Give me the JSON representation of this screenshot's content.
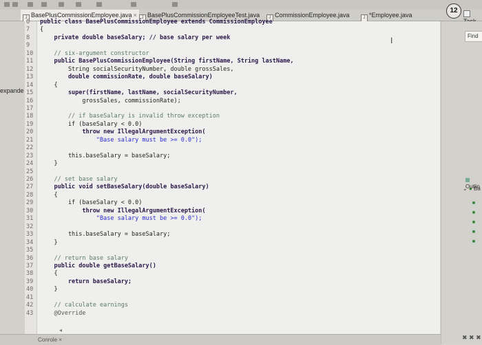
{
  "tabs": [
    {
      "label": "BasePlusCommissionEmployee.java",
      "active": true,
      "closable": true
    },
    {
      "label": "BasePlusCommissionEmployeeTest.java",
      "active": false
    },
    {
      "label": "CommissionEmployee.java",
      "active": false
    },
    {
      "label": "*Employee.java",
      "active": false
    }
  ],
  "badge_count": "12",
  "task_tab": "Task",
  "find_label": "Find",
  "outline_label": "Outlin",
  "outline_item": "Ba",
  "expand_label": "expande",
  "console_tab": "Conrole",
  "close_glyph": "×",
  "bottom_tools": "✖ ✖ ✖",
  "code_lines": [
    {
      "n": "6",
      "text": "public class BasePlusCommissionEmployee extends CommissionEmployee"
    },
    {
      "n": "7",
      "text": "{"
    },
    {
      "n": "8",
      "text": "    private double baseSalary; // base salary per week"
    },
    {
      "n": "9",
      "text": ""
    },
    {
      "n": "10",
      "text": "    // six-argument constructor"
    },
    {
      "n": "11",
      "text": "    public BasePlusCommissionEmployee(String firstName, String lastName,"
    },
    {
      "n": "12",
      "text": "        String socialSecurityNumber, double grossSales,"
    },
    {
      "n": "13",
      "text": "        double commissionRate, double baseSalary)"
    },
    {
      "n": "14",
      "text": "    {"
    },
    {
      "n": "15",
      "text": "        super(firstName, lastName, socialSecurityNumber,"
    },
    {
      "n": "16",
      "text": "            grossSales, commissionRate);"
    },
    {
      "n": "17",
      "text": ""
    },
    {
      "n": "18",
      "text": "        // if baseSalary is invalid throw exception"
    },
    {
      "n": "19",
      "text": "        if (baseSalary < 0.0)"
    },
    {
      "n": "20",
      "text": "            throw new IllegalArgumentException("
    },
    {
      "n": "21",
      "text": "                \"Base salary must be >= 0.0\");"
    },
    {
      "n": "22",
      "text": ""
    },
    {
      "n": "23",
      "text": "        this.baseSalary = baseSalary;"
    },
    {
      "n": "24",
      "text": "    }"
    },
    {
      "n": "25",
      "text": ""
    },
    {
      "n": "26",
      "text": "    // set base salary"
    },
    {
      "n": "27",
      "text": "    public void setBaseSalary(double baseSalary)"
    },
    {
      "n": "28",
      "text": "    {"
    },
    {
      "n": "29",
      "text": "        if (baseSalary < 0.0)"
    },
    {
      "n": "30",
      "text": "            throw new IllegalArgumentException("
    },
    {
      "n": "31",
      "text": "                \"Base salary must be >= 0.0\");"
    },
    {
      "n": "32",
      "text": ""
    },
    {
      "n": "33",
      "text": "        this.baseSalary = baseSalary;"
    },
    {
      "n": "34",
      "text": "    }"
    },
    {
      "n": "35",
      "text": ""
    },
    {
      "n": "36",
      "text": "    // return base salary"
    },
    {
      "n": "37",
      "text": "    public double getBaseSalary()"
    },
    {
      "n": "38",
      "text": "    {"
    },
    {
      "n": "39",
      "text": "        return baseSalary;"
    },
    {
      "n": "40",
      "text": "    }"
    },
    {
      "n": "41",
      "text": ""
    },
    {
      "n": "42",
      "text": "    // calculate earnings"
    },
    {
      "n": "43",
      "text": "    @Override"
    }
  ],
  "colors": {
    "editor_bg": "#efefed",
    "keyword": "#2b1a4a",
    "comment": "#5b7a6a",
    "string": "#2a2ad0"
  }
}
